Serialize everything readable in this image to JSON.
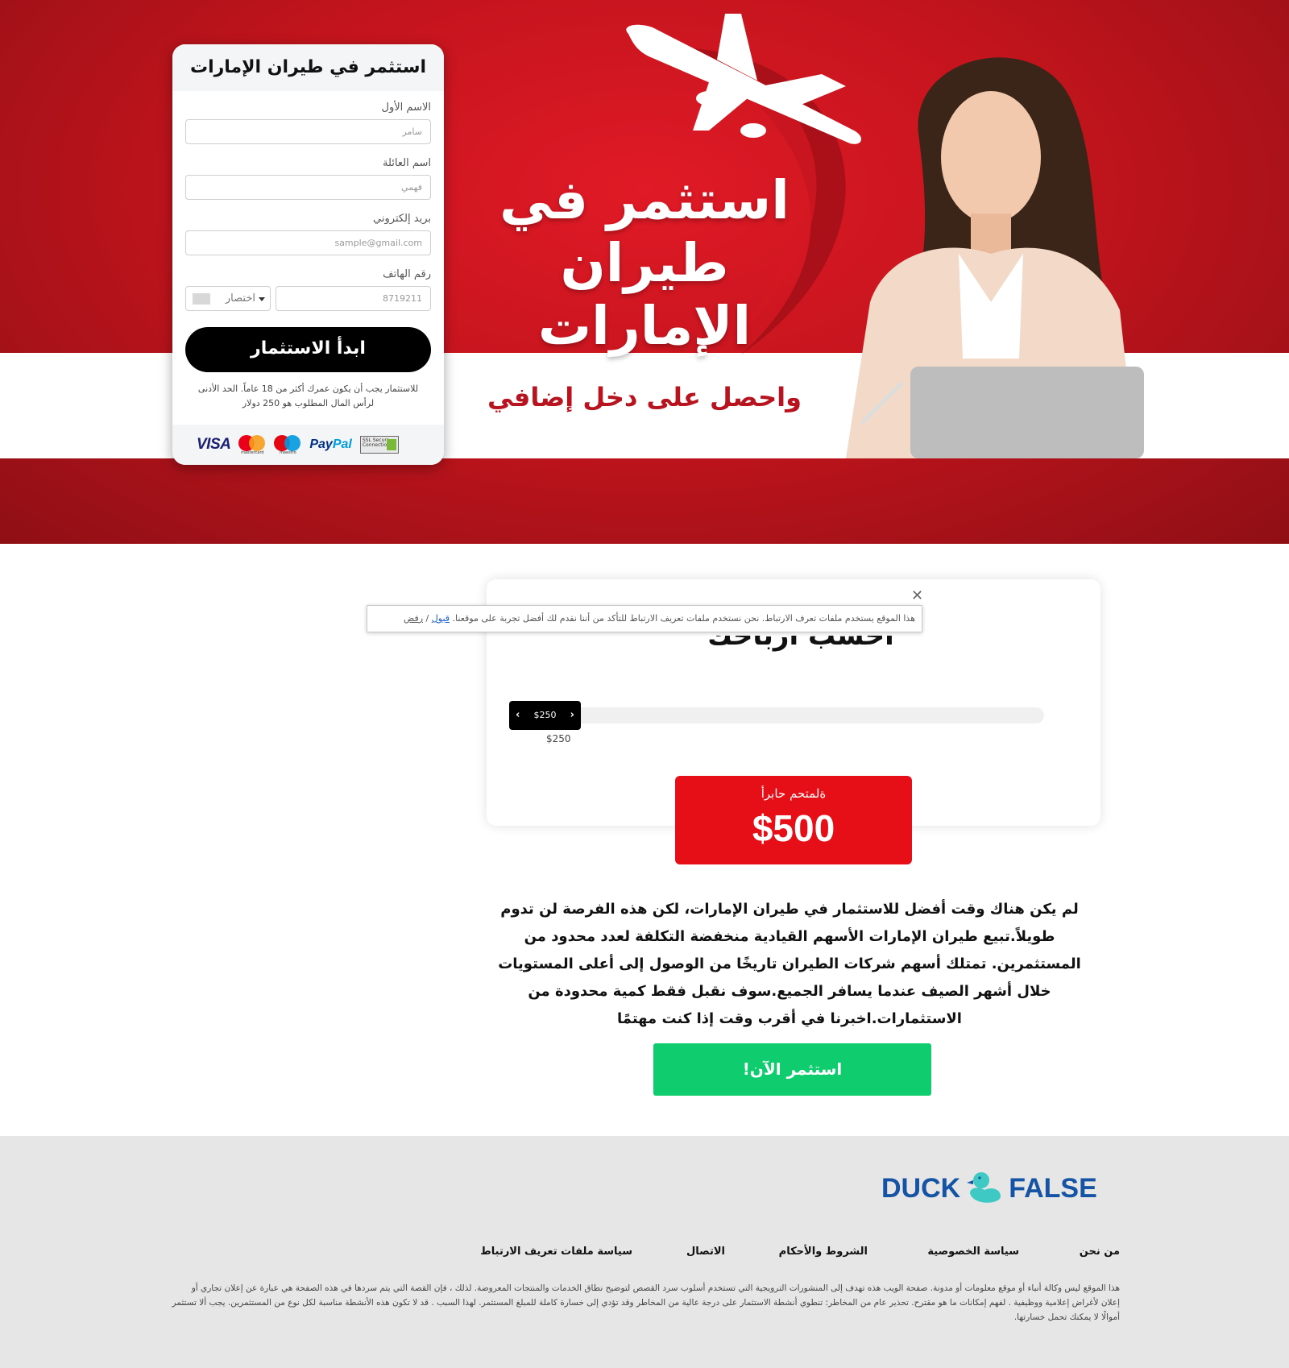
{
  "hero": {
    "title": "استثمر في طيران الإمارات",
    "subtitle": "واحصل على دخل إضافي"
  },
  "form": {
    "title": "استثمر في طيران الإمارات",
    "first_name": {
      "label": "الاسم الأول",
      "placeholder": "سامر"
    },
    "last_name": {
      "label": "اسم العائلة",
      "placeholder": "فهمي"
    },
    "email": {
      "label": "بريد إلكتروني",
      "placeholder": "sample@gmail.com"
    },
    "phone": {
      "label": "رقم الهاتف",
      "placeholder": "8719211",
      "code_label": "اختصار"
    },
    "submit_label": "ابدأ الاستثمار",
    "note": "للاستثمار يجب أن يكون عمرك أكثر من 18 عاماً. الحد الأدنى لرأس المال المطلوب هو 250 دولار",
    "payments": {
      "visa": "VISA",
      "mastercard": "mastercard",
      "maestro": "maestro",
      "paypal_a": "Pay",
      "paypal_b": "Pal",
      "ssl": "SSL Secure Connection"
    }
  },
  "cookie": {
    "text": "هذا الموقع يستخدم ملفات تعرف الارتباط. نحن نستخدم ملفات تعريف الارتباط للتأكد من أننا نقدم لك أفضل تجربة على موقعنا.",
    "accept": "قبول",
    "separator": " / ",
    "reject": "رفض",
    "close": "✕"
  },
  "calculator": {
    "title": "احسب أرباحك",
    "slider_value": "$250",
    "slider_caption": "$250",
    "slider_level": 0,
    "profit_label": "ةلمتحم حابرأ",
    "profit_value": "$500"
  },
  "promo": {
    "text": "لم يكن هناك وقت أفضل للاستثمار في طيران الإمارات، لكن هذه الفرصة لن تدوم طويلاً.تبيع طيران الإمارات الأسهم القيادية منخفضة التكلفة لعدد محدود من المستثمرين. تمتلك أسهم شركات الطيران تاريخًا من الوصول إلى أعلى المستويات خلال أشهر الصيف عندما يسافر الجميع.سوف نقبل فقط كمية محدودة من الاستثمارات.اخبرنا في أقرب وقت إذا كنت مهتمًا",
    "cta": "استثمر الآن!"
  },
  "footer": {
    "logo_left": "DUCK",
    "logo_right": "FALSE",
    "nav": [
      "من نحن",
      "سياسة الخصوصية",
      "الشروط والأحكام",
      "الاتصال",
      "سياسة ملفات تعريف الارتباط"
    ],
    "disclaimer": "هذا الموقع ليس وكالة أنباء أو موقع معلومات أو مدونة. صفحة الويب هذه تهدف إلى المنشورات الترويجية التي تستخدم أسلوب سرد القصص لتوضيح نطاق الخدمات والمنتجات المعروضة. لذلك ، فإن القصة التي يتم سردها في هذه الصفحة هي عبارة عن إعلان تجاري أو إعلان لأغراض إعلامية ووظيفية . لفهم إمكانات ما هو مقترح. تحذير عام من المخاطر: تنطوي أنشطة الاستثمار على درجة عالية من المخاطر وقد تؤدي إلى خسارة كاملة للمبلغ المستثمر. لهذا السبب . قد لا تكون هذه الأنشطة مناسبة لكل نوع من المستثمرين. يجب ألا تستثمر أموالًا لا يمكنك تحمل خسارتها."
  },
  "colors": {
    "hero_red": "#c4141d",
    "cta_green": "#0fcc6f",
    "profit_red": "#e60f18",
    "logo_blue": "#1553a5",
    "duck_teal": "#3fc9c4"
  }
}
